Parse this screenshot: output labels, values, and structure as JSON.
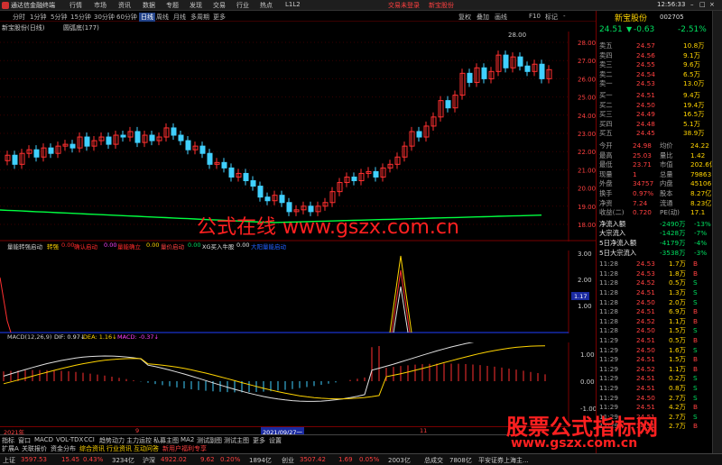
{
  "titlebar": {
    "app_name": "通达信金融终端",
    "menus": [
      "行情",
      "市场",
      "资讯",
      "数据",
      "专题",
      "发现",
      "交易",
      "行业",
      "热点",
      "L1L2"
    ],
    "links": [
      "交易未登录",
      "新宝股份"
    ],
    "time": "12:56:33"
  },
  "toolbar": {
    "items": [
      "分时",
      "1分钟",
      "5分钟",
      "15分钟",
      "30分钟",
      "60分钟",
      "日线",
      "周线",
      "月线",
      "多周期",
      "更多"
    ],
    "selected": "日线",
    "right": [
      "复权",
      "叠加",
      "画线",
      "F10",
      "标记",
      "-"
    ]
  },
  "chart_info": {
    "stock": "新宝股份(日线)",
    "indicator": "圆弧底(177)"
  },
  "price_axis": [
    "28.00",
    "27.00",
    "26.00",
    "25.00",
    "24.00",
    "23.00",
    "22.00",
    "21.00",
    "20.00",
    "19.00",
    "18.00"
  ],
  "peak_label": "28.00",
  "watermark1": "公式在线 www.gszx.com.cn",
  "indicator_panel": {
    "head": "量能转强启动",
    "items": [
      {
        "label": "转强",
        "color": "#ffd400"
      },
      {
        "label": "0.00",
        "color": "#ff2a2a"
      },
      {
        "label": "确认启动",
        "color": "#ff2a2a"
      },
      {
        "label": "0.00",
        "color": "#ff40ff"
      },
      {
        "label": "量能确立",
        "color": "#ff2a2a"
      },
      {
        "label": "0.00",
        "color": "#ffd400"
      },
      {
        "label": "量价启动",
        "color": "#ff4040"
      },
      {
        "label": "0.00",
        "color": "#00e060"
      },
      {
        "label": "XG买入牛股",
        "color": "#e0e0e0"
      },
      {
        "label": "0.00",
        "color": "#e0e0e0"
      },
      {
        "label": "大阳量能启动",
        "color": "#2060ff"
      }
    ],
    "axis": [
      "3.00",
      "2.00",
      "1.00"
    ],
    "marker": "1.17"
  },
  "macd": {
    "head": "MACD(12,26,9)",
    "dif": "DIF: 0.97↓",
    "dea": "DEA: 1.16↓",
    "macd": "MACD: -0.37↓",
    "axis": [
      "1.00",
      "0.00",
      "-1.00"
    ]
  },
  "dates": {
    "year": "2021年",
    "month": "9",
    "cursor": "2021/09/27一",
    "end": "11"
  },
  "right_panel": {
    "stock_name": "新宝股份",
    "code": "002705",
    "price": "24.51",
    "change": "-0.63",
    "pct": "-2.51%",
    "asks": [
      {
        "label": "卖五",
        "price": "24.57",
        "vol": "10.8万"
      },
      {
        "label": "卖四",
        "price": "24.56",
        "vol": "9.1万"
      },
      {
        "label": "卖三",
        "price": "24.55",
        "vol": "9.6万"
      },
      {
        "label": "卖二",
        "price": "24.54",
        "vol": "6.5万"
      },
      {
        "label": "卖一",
        "price": "24.53",
        "vol": "13.0万"
      }
    ],
    "bids": [
      {
        "label": "买一",
        "price": "24.51",
        "vol": "9.4万"
      },
      {
        "label": "买二",
        "price": "24.50",
        "vol": "19.4万"
      },
      {
        "label": "买三",
        "price": "24.49",
        "vol": "16.5万"
      },
      {
        "label": "买四",
        "price": "24.48",
        "vol": "5.1万"
      },
      {
        "label": "买五",
        "price": "24.45",
        "vol": "38.9万"
      }
    ],
    "stats": [
      {
        "l1": "今开",
        "v1": "24.98",
        "l2": "均价",
        "v2": "24.22"
      },
      {
        "l1": "最高",
        "v1": "25.03",
        "l2": "量比",
        "v2": "1.42"
      },
      {
        "l1": "最低",
        "v1": "23.71",
        "l2": "市值",
        "v2": "202.6亿"
      },
      {
        "l1": "现量",
        "v1": "1",
        "l2": "总量",
        "v2": "79863"
      },
      {
        "l1": "外盘",
        "v1": "34757",
        "l2": "内盘",
        "v2": "45106"
      },
      {
        "l1": "换手",
        "v1": "0.97%",
        "l2": "股本",
        "v2": "8.27亿"
      },
      {
        "l1": "净资",
        "v1": "7.24",
        "l2": "流通",
        "v2": "8.23亿"
      },
      {
        "l1": "收益(二)",
        "v1": "0.720",
        "l2": "PE(动)",
        "v2": "17.1"
      }
    ],
    "flows": [
      {
        "l": "净流入额",
        "v": "-2490万",
        "p": "-13%"
      },
      {
        "l": "大宗流入",
        "v": "-1428万",
        "p": "-7%"
      },
      {
        "l": "5日净流入额",
        "v": "-4179万",
        "p": "-4%"
      },
      {
        "l": "5日大宗流入",
        "v": "-3538万",
        "p": "-3%"
      }
    ],
    "ticks": [
      {
        "t": "11:28",
        "p": "24.53",
        "v": "1.7万",
        "s": "B"
      },
      {
        "t": "11:28",
        "p": "24.53",
        "v": "1.8万",
        "s": "B"
      },
      {
        "t": "11:28",
        "p": "24.52",
        "v": "0.5万",
        "s": "S"
      },
      {
        "t": "11:28",
        "p": "24.51",
        "v": "1.3万",
        "s": "S"
      },
      {
        "t": "11:28",
        "p": "24.50",
        "v": "2.0万",
        "s": "S"
      },
      {
        "t": "11:28",
        "p": "24.51",
        "v": "6.9万",
        "s": "B"
      },
      {
        "t": "11:28",
        "p": "24.52",
        "v": "1.1万",
        "s": "B"
      },
      {
        "t": "11:28",
        "p": "24.50",
        "v": "1.5万",
        "s": "S"
      },
      {
        "t": "11:29",
        "p": "24.51",
        "v": "0.5万",
        "s": "B"
      },
      {
        "t": "11:29",
        "p": "24.50",
        "v": "1.6万",
        "s": "S"
      },
      {
        "t": "11:29",
        "p": "24.51",
        "v": "1.5万",
        "s": "B"
      },
      {
        "t": "11:29",
        "p": "24.52",
        "v": "1.1万",
        "s": "B"
      },
      {
        "t": "11:29",
        "p": "24.51",
        "v": "0.2万",
        "s": "S"
      },
      {
        "t": "11:29",
        "p": "24.51",
        "v": "0.8万",
        "s": "S"
      },
      {
        "t": "11:29",
        "p": "24.50",
        "v": "2.7万",
        "s": "S"
      },
      {
        "t": "11:29",
        "p": "24.51",
        "v": "4.2万",
        "s": "B"
      },
      {
        "t": "11:29",
        "p": "24.51",
        "v": "2.7万",
        "s": "S"
      },
      {
        "t": "11:29",
        "p": "24.51",
        "v": "2.7万",
        "s": "B"
      }
    ],
    "watermark2": "股票公式指标网",
    "watermark3": "www.gszx.com.cn"
  },
  "bottom_tabs": [
    "指标",
    "窗口",
    "MACD",
    "VOL-TDX",
    "CCI",
    "趋势动力",
    "主力运控",
    "私募主图",
    "MA2",
    "测试副图",
    "测试主图",
    "更多",
    "设置"
  ],
  "bottom_tabs2": [
    "扩展A",
    "关联报价",
    "资金分布",
    "综合资讯",
    "行业资讯",
    "互动问答",
    "新用户福利专享"
  ],
  "statusbar": {
    "items": [
      {
        "name": "上证",
        "val": "3597.53",
        "chg": "15.45",
        "pct": "0.43%",
        "amt": "3234亿"
      },
      {
        "name": "沪深",
        "val": "4922.02",
        "chg": "9.62",
        "pct": "0.20%",
        "amt": "1894亿"
      },
      {
        "name": "创业",
        "val": "3507.42",
        "chg": "1.69",
        "pct": "0.05%",
        "amt": "2003亿"
      }
    ],
    "total_label": "总成交",
    "total": "7808亿",
    "broker": "平安证券上海主..."
  }
}
